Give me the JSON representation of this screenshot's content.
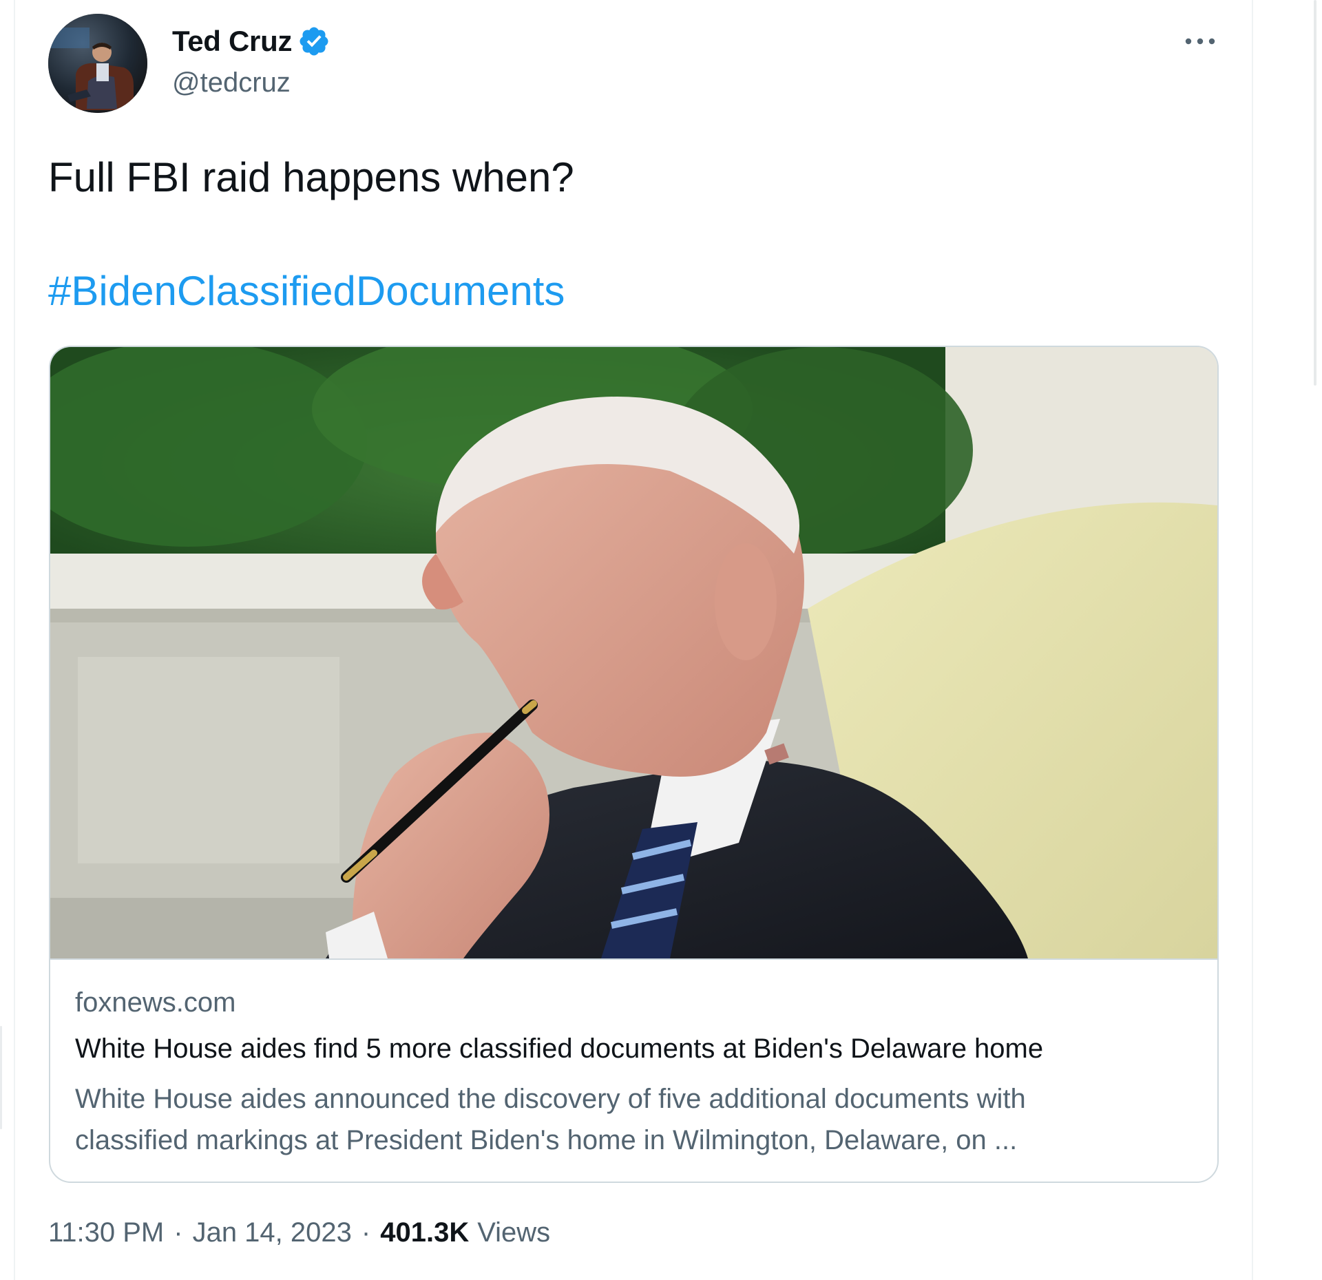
{
  "tweet": {
    "author": {
      "display_name": "Ted Cruz",
      "handle": "@tedcruz",
      "verified": true
    },
    "text": "Full FBI raid happens when?",
    "hashtag": "#BidenClassifiedDocuments",
    "more_icon": "more-horizontal-icon"
  },
  "card": {
    "domain": "foxnews.com",
    "title": "White House aides find 5 more classified documents at Biden's Delaware home",
    "description_line1": "White House aides announced the discovery of five additional documents with",
    "description_line2": "classified markings at President Biden's home in Wilmington, Delaware, on ..."
  },
  "meta": {
    "time": "11:30 PM",
    "separator": "·",
    "date": "Jan 14, 2023",
    "views_count": "401.3K",
    "views_label": "Views"
  },
  "colors": {
    "accent": "#1d9bf0",
    "text_primary": "#0f1419",
    "text_secondary": "#536471",
    "border": "#cfd9de"
  }
}
